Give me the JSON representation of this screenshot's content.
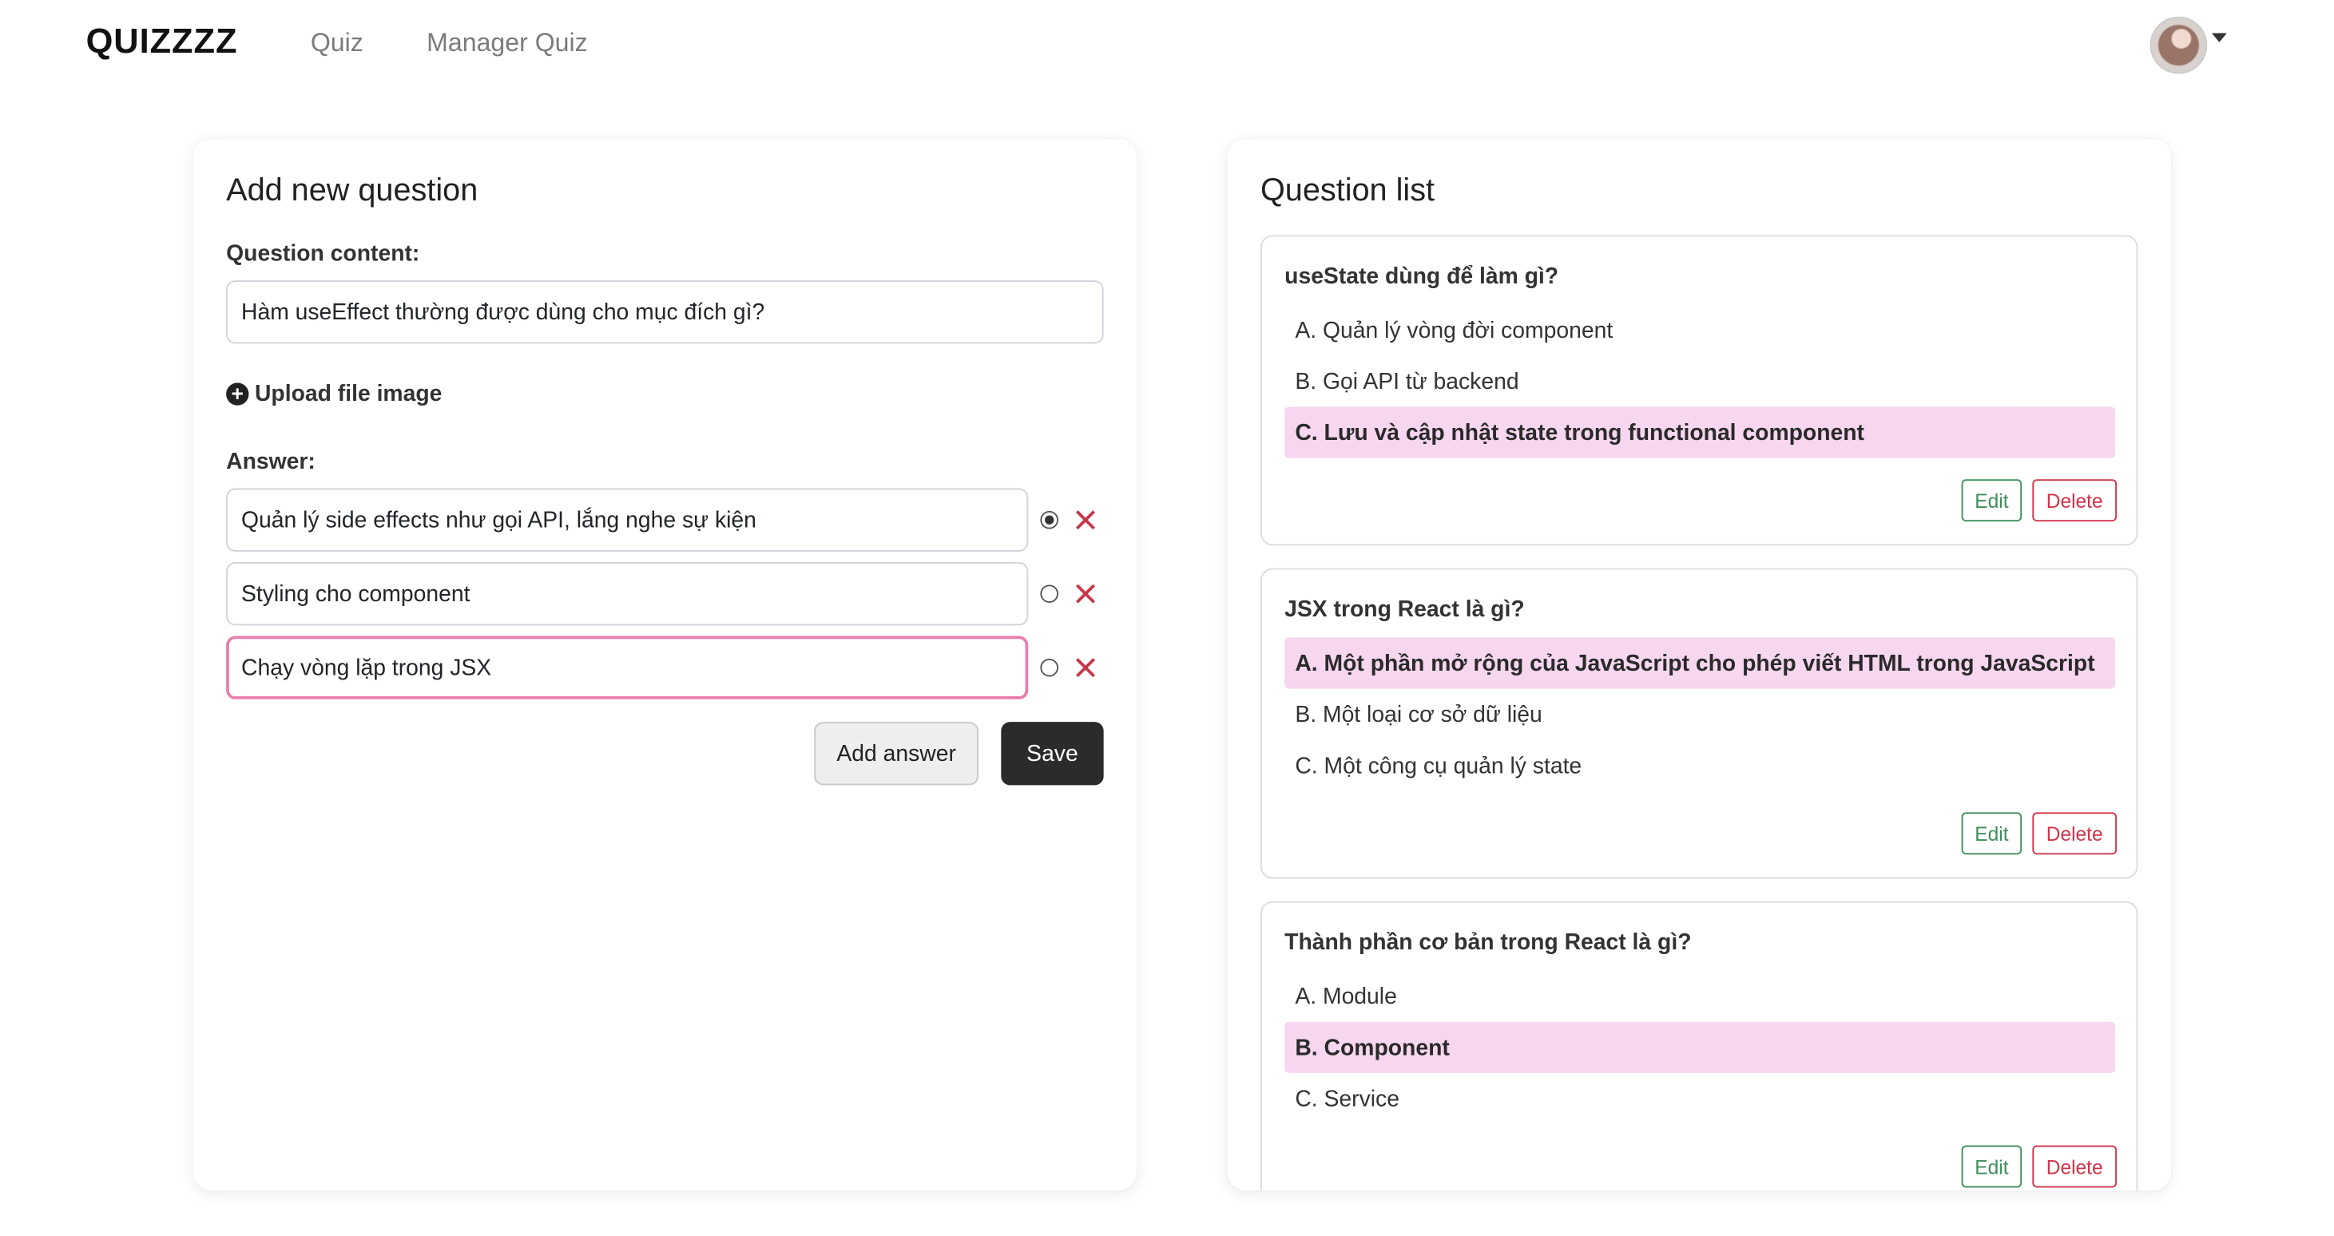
{
  "navbar": {
    "brand": "QUIZZZZ",
    "links": [
      "Quiz",
      "Manager Quiz"
    ]
  },
  "form": {
    "title": "Add new question",
    "content_label": "Question content:",
    "content_value": "Hàm useEffect thường được dùng cho mục đích gì?",
    "upload_label": "Upload file image",
    "answer_label": "Answer:",
    "answers": [
      {
        "text": "Quản lý side effects như gọi API, lắng nghe sự kiện",
        "correct": true
      },
      {
        "text": "Styling cho component",
        "correct": false
      },
      {
        "text": "Chạy vòng lặp trong JSX",
        "correct": false
      }
    ],
    "add_answer_label": "Add answer",
    "save_label": "Save"
  },
  "list": {
    "title": "Question list",
    "edit_label": "Edit",
    "delete_label": "Delete",
    "questions": [
      {
        "question": "useState dùng để làm gì?",
        "options": [
          "A. Quản lý vòng đời component",
          "B. Gọi API từ backend",
          "C. Lưu và cập nhật state trong functional component"
        ],
        "correct_index": 2
      },
      {
        "question": "JSX trong React là gì?",
        "options": [
          "A. Một phần mở rộng của JavaScript cho phép viết HTML trong JavaScript",
          "B. Một loại cơ sở dữ liệu",
          "C. Một công cụ quản lý state"
        ],
        "correct_index": 0
      },
      {
        "question": "Thành phần cơ bản trong React là gì?",
        "options": [
          "A. Module",
          "B. Component",
          "C. Service"
        ],
        "correct_index": 1
      }
    ]
  },
  "colors": {
    "correct_highlight": "#f7d6f0",
    "focus_border": "#e87fab",
    "edit": "#3f8f5b",
    "delete": "#d0344b"
  },
  "icons": [
    "plus-circle-icon",
    "radio-icon",
    "close-icon",
    "avatar",
    "caret-down-icon"
  ]
}
